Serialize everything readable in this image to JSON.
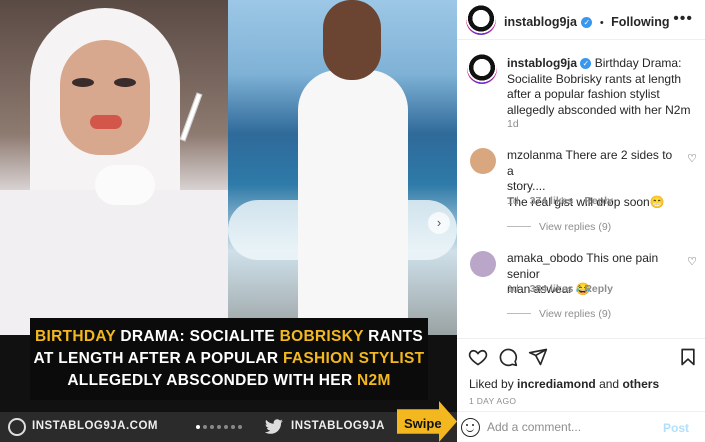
{
  "media": {
    "headline_lines": [
      [
        {
          "t": "BIRTHDAY",
          "hl": true
        },
        {
          "t": " DRAMA: SOCIALITE ",
          "hl": false
        },
        {
          "t": "BOBRISKY",
          "hl": true
        },
        {
          "t": " RANTS",
          "hl": false
        }
      ],
      [
        {
          "t": "AT LENGTH AFTER A POPULAR ",
          "hl": false
        },
        {
          "t": "FASHION STYLIST",
          "hl": true
        }
      ],
      [
        {
          "t": "ALLEGEDLY ABSCONDED WITH HER ",
          "hl": false
        },
        {
          "t": "N2M",
          "hl": true
        }
      ]
    ],
    "footer_site": "INSTABLOG9JA.COM",
    "footer_handle": "INSTABLOG9JA",
    "swipe_label": "Swipe",
    "next_arrow": "›",
    "carousel_dots": 7,
    "carousel_active": 0,
    "highlight_color": "#f3b81f"
  },
  "header": {
    "username": "instablog9ja",
    "verified": "✓",
    "separator": "•",
    "follow_label": "Following",
    "more_label": "•••"
  },
  "caption": {
    "username": "instablog9ja",
    "verified": "✓",
    "text": "Birthday Drama: Socialite Bobrisky rants at length after a popular fashion stylist allegedly absconded with her N2m",
    "time": "1d"
  },
  "comments": [
    {
      "username": "mzolanma",
      "text_lines": [
        "There are 2 sides to a",
        "story....",
        "The real gist will drop soon😁"
      ],
      "time": "1d",
      "likes": "374 likes",
      "reply_label": "Reply",
      "view_replies": "View replies (9)",
      "avatar_color": "#d9a77f"
    },
    {
      "username": "amaka_obodo",
      "text_lines": [
        "This one pain senior",
        "man aswear 😂"
      ],
      "time": "1d",
      "likes": "384 likes",
      "reply_label": "Reply",
      "view_replies": "View replies (9)",
      "avatar_color": "#b9a6c9"
    }
  ],
  "actions": {
    "like_icon": "heart-icon",
    "comment_icon": "comment-icon",
    "share_icon": "share-icon",
    "save_icon": "bookmark-icon"
  },
  "likes": {
    "prefix": "Liked by",
    "user": "incrediamond",
    "conjunction": "and",
    "others": "others"
  },
  "date": "1 DAY AGO",
  "add_comment": {
    "placeholder": "Add a comment...",
    "post_label": "Post"
  }
}
